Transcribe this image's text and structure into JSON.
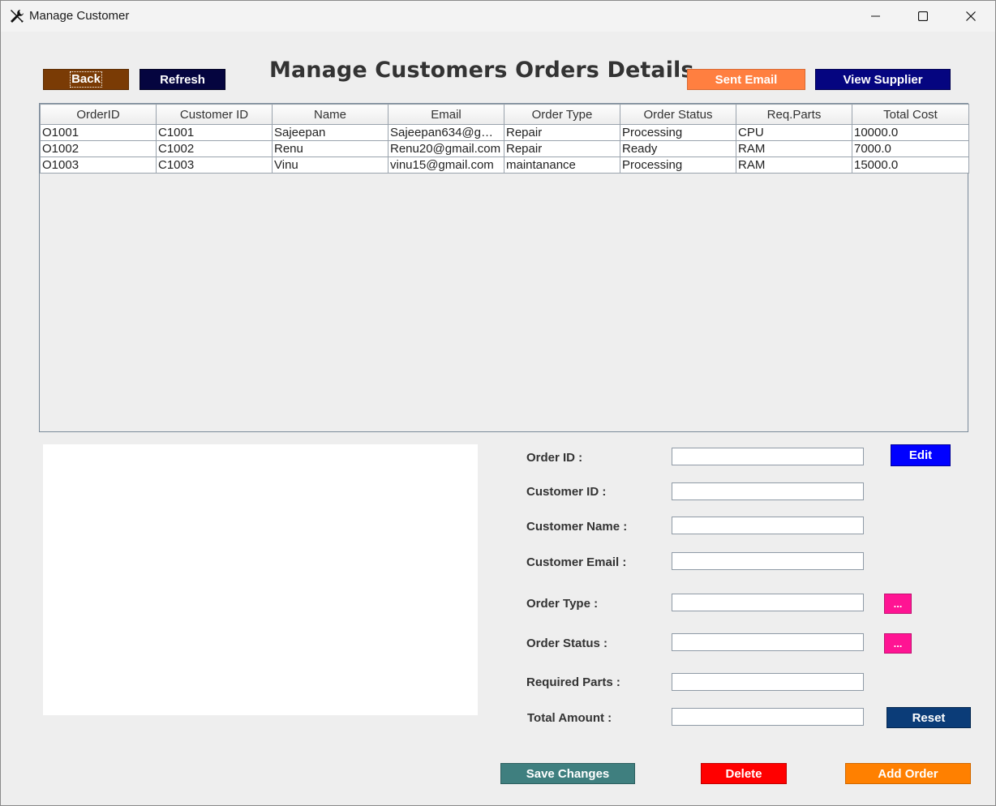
{
  "window": {
    "title": "Manage Customer"
  },
  "toolbar": {
    "back_label": "Back",
    "refresh_label": "Refresh",
    "sent_email_label": "Sent Email",
    "view_supplier_label": "View Supplier"
  },
  "page_title": "Manage Customers Orders Details",
  "table": {
    "columns": [
      "OrderID",
      "Customer ID",
      "Name",
      "Email",
      "Order Type",
      "Order Status",
      "Req.Parts",
      "Total Cost"
    ],
    "rows": [
      [
        "O1001",
        "C1001",
        "Sajeepan",
        "Sajeepan634@gmai...",
        "Repair",
        "Processing",
        "CPU",
        "10000.0"
      ],
      [
        "O1002",
        "C1002",
        "Renu",
        "Renu20@gmail.com",
        "Repair",
        "Ready",
        "RAM",
        "7000.0"
      ],
      [
        "O1003",
        "C1003",
        "Vinu",
        "vinu15@gmail.com",
        "maintanance",
        "Processing",
        "RAM",
        "15000.0"
      ]
    ]
  },
  "form": {
    "order_id_label": "Order ID :",
    "customer_id_label": "Customer ID :",
    "customer_name_label": "Customer Name :",
    "customer_email_label": "Customer Email :",
    "order_type_label": "Order Type :",
    "order_status_label": "Order Status :",
    "required_parts_label": "Required Parts :",
    "total_amount_label": "Total Amount :",
    "order_id_value": "",
    "customer_id_value": "",
    "customer_name_value": "",
    "customer_email_value": "",
    "order_type_value": "",
    "order_status_value": "",
    "required_parts_value": "",
    "total_amount_value": "",
    "edit_label": "Edit",
    "order_type_picker_label": "...",
    "order_status_picker_label": "...",
    "reset_label": "Reset"
  },
  "actions": {
    "save_changes_label": "Save Changes",
    "delete_label": "Delete",
    "add_order_label": "Add Order"
  },
  "colors": {
    "back": "#7a3b05",
    "refresh": "#05053f",
    "sent_email": "#ff7f40",
    "view_supplier": "#050580",
    "edit": "#0000ff",
    "picker": "#ff1493",
    "reset": "#0b3c78",
    "save_changes": "#3f7f7f",
    "delete": "#ff0000",
    "add_order": "#ff8000"
  }
}
